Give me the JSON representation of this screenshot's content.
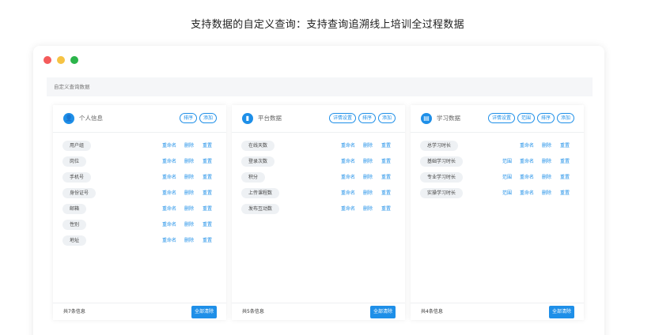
{
  "headline": "支持数据的自定义查询：支持查询追溯线上培训全过程数据",
  "colors": {
    "accent": "#1e8fe8",
    "close": "#f45b5b",
    "minimize": "#f6c344",
    "maximize": "#2bb44a"
  },
  "window": {
    "subbar_label": "自定义查询数据"
  },
  "panels": [
    {
      "icon": "user-icon",
      "title": "个人信息",
      "buttons": [
        "排序",
        "添加"
      ],
      "rows": [
        {
          "label": "用户组",
          "actions": [
            "重命名",
            "删除",
            "重置"
          ]
        },
        {
          "label": "岗位",
          "actions": [
            "重命名",
            "删除",
            "重置"
          ]
        },
        {
          "label": "手机号",
          "actions": [
            "重命名",
            "删除",
            "重置"
          ]
        },
        {
          "label": "身份证号",
          "actions": [
            "重命名",
            "删除",
            "重置"
          ]
        },
        {
          "label": "邮箱",
          "actions": [
            "重命名",
            "删除",
            "重置"
          ]
        },
        {
          "label": "性别",
          "actions": [
            "重命名",
            "删除",
            "重置"
          ]
        },
        {
          "label": "地址",
          "actions": [
            "重命名",
            "删除",
            "重置"
          ]
        }
      ],
      "count": "共7条信息",
      "clear": "全部清除"
    },
    {
      "icon": "bar-chart-icon",
      "title": "平台数据",
      "buttons": [
        "详情设置",
        "排序",
        "添加"
      ],
      "rows": [
        {
          "label": "在线天数",
          "actions": [
            "重命名",
            "删除",
            "重置"
          ]
        },
        {
          "label": "登录次数",
          "actions": [
            "重命名",
            "删除",
            "重置"
          ]
        },
        {
          "label": "积分",
          "actions": [
            "重命名",
            "删除",
            "重置"
          ]
        },
        {
          "label": "上传课程数",
          "actions": [
            "重命名",
            "删除",
            "重置"
          ]
        },
        {
          "label": "发布互动数",
          "actions": [
            "重命名",
            "删除",
            "重置"
          ]
        }
      ],
      "count": "共5条信息",
      "clear": "全部清除"
    },
    {
      "icon": "book-icon",
      "title": "学习数据",
      "buttons": [
        "详情设置",
        "范围",
        "排序",
        "添加"
      ],
      "rows": [
        {
          "label": "总学习时长",
          "actions": [
            "重命名",
            "删除",
            "重置"
          ]
        },
        {
          "label": "基础学习时长",
          "actions": [
            "范围",
            "重命名",
            "删除",
            "重置"
          ]
        },
        {
          "label": "专业学习时长",
          "actions": [
            "范围",
            "重命名",
            "删除",
            "重置"
          ]
        },
        {
          "label": "实操学习时长",
          "actions": [
            "范围",
            "重命名",
            "删除",
            "重置"
          ]
        }
      ],
      "count": "共4条信息",
      "clear": "全部清除"
    }
  ]
}
